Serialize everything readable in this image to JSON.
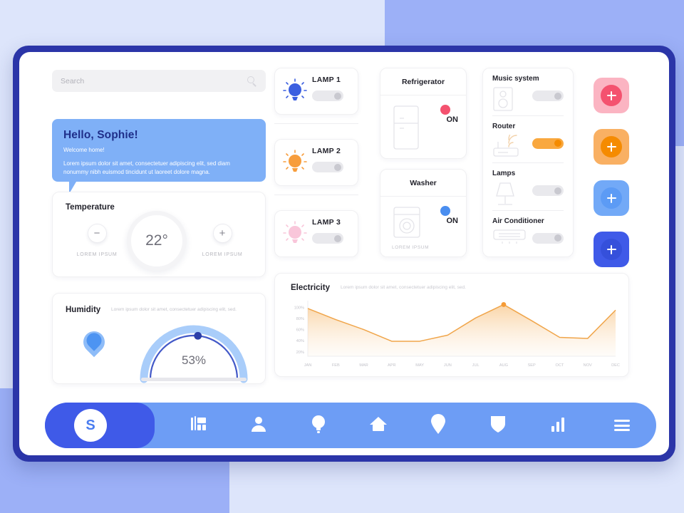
{
  "theme": {
    "frame": "#2b35a8",
    "bg_light": "#dde5fb",
    "bg_accent": "#9cb0f7",
    "nav_bar": "#6d9df5",
    "nav_home": "#3f5ae8",
    "greeting_bg": "#7fb0f7",
    "accent_orange": "#f79d3c",
    "accent_pink": "#f9778f",
    "accent_blue": "#6fa8f6",
    "accent_indigo": "#3f5ae8"
  },
  "search": {
    "placeholder": "Search",
    "value": "",
    "icon": "search-icon"
  },
  "greeting": {
    "title": "Hello, Sophie!",
    "subtitle": "Welcome home!",
    "body": "Lorem ipsum dolor sit amet, consectetuer adipiscing elit, sed diam nonummy nibh euismod tincidunt ut laoreet dolore magna."
  },
  "temperature": {
    "title": "Temperature",
    "value": "22°",
    "decrease_label": "−",
    "increase_label": "+",
    "left_caption": "LOREM IPSUM",
    "right_caption": "LOREM IPSUM"
  },
  "humidity": {
    "title": "Humidity",
    "description": "Lorem ipsum dolor sit amet, consectetuer adipiscing elit, sed.",
    "value": "53%",
    "percent": 53,
    "icon": "water-drop-icon"
  },
  "lamps": [
    {
      "label": "LAMP 1",
      "icon": "light-bulb-icon",
      "color": "#3b5fe0",
      "state": "off"
    },
    {
      "label": "LAMP 2",
      "icon": "light-bulb-icon",
      "color": "#f79d3c",
      "state": "off"
    },
    {
      "label": "LAMP 3",
      "icon": "light-bulb-icon",
      "color": "#f9b8d0",
      "state": "off"
    }
  ],
  "appliances": [
    {
      "title": "Refrigerator",
      "icon": "refrigerator-icon",
      "state": "on",
      "state_label": "ON",
      "toggle_color": "#fa8aa0",
      "knob_color": "#f4526f",
      "caption": ""
    },
    {
      "title": "Washer",
      "icon": "washing-machine-icon",
      "state": "on",
      "state_label": "ON",
      "toggle_color": "#7fb0f7",
      "knob_color": "#4a8ef0",
      "caption": "LOREM IPSUM"
    }
  ],
  "device_list": [
    {
      "name": "Music system",
      "icon": "speaker-icon",
      "state": "off",
      "toggle_color": "#e9e9ed"
    },
    {
      "name": "Router",
      "icon": "router-icon",
      "state": "on",
      "toggle_color": "#f9a83f",
      "knob_color": "#f58b00"
    },
    {
      "name": "Lamps",
      "icon": "table-lamp-icon",
      "state": "off",
      "toggle_color": "#e9e9ed"
    },
    {
      "name": "Air Conditioner",
      "icon": "air-conditioner-icon",
      "state": "off",
      "toggle_color": "#e9e9ed"
    }
  ],
  "add_buttons": [
    {
      "name": "add-device-pink",
      "label": "+",
      "outer": "#fbb4c2",
      "inner": "#f4526f"
    },
    {
      "name": "add-device-orange",
      "label": "+",
      "outer": "#f9b063",
      "inner": "#f58b00"
    },
    {
      "name": "add-device-blue",
      "label": "+",
      "outer": "#72a9f7",
      "inner": "#5c9bf5"
    },
    {
      "name": "add-device-indigo",
      "label": "+",
      "outer": "#3f5ae8",
      "inner": "#3550db"
    }
  ],
  "chart_data": {
    "type": "area",
    "title": "Electricity",
    "subtitle": "Lorem ipsum dolor sit amet, consectetuer adipiscing elit, sed.",
    "categories": [
      "JAN",
      "FEB",
      "MAR",
      "APR",
      "MAY",
      "JUN",
      "JUL",
      "AUG",
      "SEP",
      "OCT",
      "NOV",
      "DEC"
    ],
    "values": [
      98,
      78,
      60,
      39,
      39,
      50,
      81,
      105,
      76,
      46,
      44,
      95
    ],
    "ytick_labels": [
      "100%",
      "80%",
      "60%",
      "40%",
      "20%"
    ],
    "yticks": [
      100,
      80,
      60,
      40,
      20
    ],
    "ylim": [
      12,
      112
    ],
    "xlabel": "",
    "ylabel": "",
    "grid": false,
    "legend": "none",
    "line_color": "#f2a košíč",
    "highlight": {
      "category": "AUG",
      "value": 105
    }
  },
  "navbar": {
    "avatar_initial": "S",
    "items": [
      {
        "name": "nav-dashboard",
        "icon": "dashboard-grid-icon"
      },
      {
        "name": "nav-profile",
        "icon": "person-icon"
      },
      {
        "name": "nav-lighting",
        "icon": "light-bulb-icon"
      },
      {
        "name": "nav-home",
        "icon": "home-icon"
      },
      {
        "name": "nav-location",
        "icon": "location-pin-icon"
      },
      {
        "name": "nav-security",
        "icon": "shield-icon"
      },
      {
        "name": "nav-statistics",
        "icon": "bar-chart-icon"
      }
    ],
    "menu_icon": "hamburger-menu-icon"
  }
}
